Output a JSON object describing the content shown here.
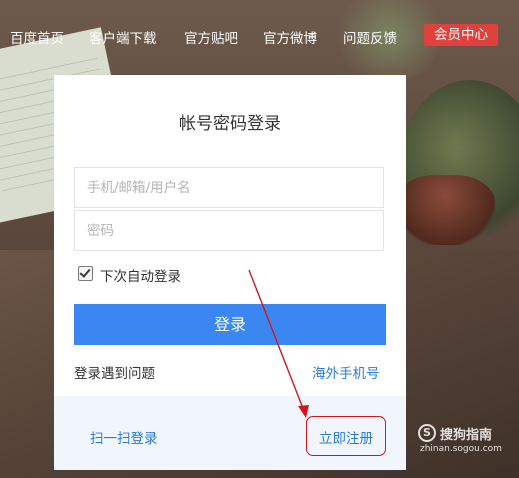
{
  "nav": {
    "items": [
      "百度首页",
      "客户端下载",
      "官方贴吧",
      "官方微博",
      "问题反馈"
    ],
    "member_center": "会员中心"
  },
  "login": {
    "title": "帐号密码登录",
    "username_placeholder": "手机/邮箱/用户名",
    "password_placeholder": "密码",
    "remember_label": "下次自动登录",
    "remember_checked": true,
    "login_button": "登录",
    "problem_link": "登录遇到问题",
    "overseas_link": "海外手机号",
    "scan_link": "扫一扫登录",
    "register_link": "立即注册"
  },
  "annotation": {
    "arrow_color": "#d4161b",
    "highlight_target": "立即注册"
  },
  "watermark": {
    "icon": "sogou-s-logo",
    "text": "搜狗指南",
    "url": "zhinan.sogou.com"
  },
  "colors": {
    "primary": "#3a87f1",
    "member_badge": "#e0413d",
    "link": "#2a7bd6",
    "annotation": "#d4161b"
  }
}
